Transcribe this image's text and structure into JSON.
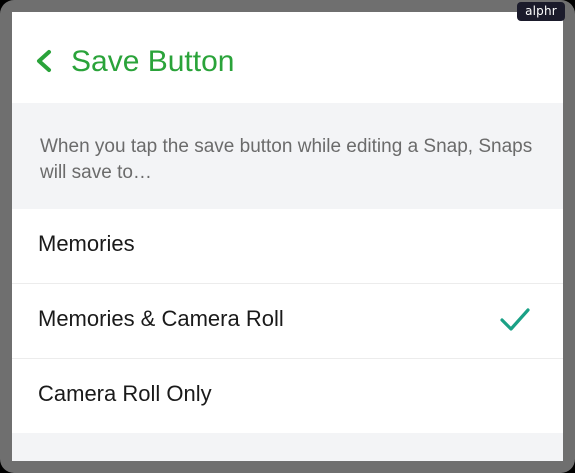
{
  "watermark": "alphr",
  "header": {
    "back_icon": "chevron-left-icon",
    "title": "Save Button"
  },
  "description": "When you tap the save button while editing a Snap, Snaps will save to…",
  "options": [
    {
      "label": "Memories",
      "selected": false
    },
    {
      "label": "Memories & Camera Roll",
      "selected": true
    },
    {
      "label": "Camera Roll Only",
      "selected": false
    }
  ],
  "colors": {
    "accent": "#2aa33a",
    "check": "#1aa186",
    "section_bg": "#f3f4f6"
  }
}
